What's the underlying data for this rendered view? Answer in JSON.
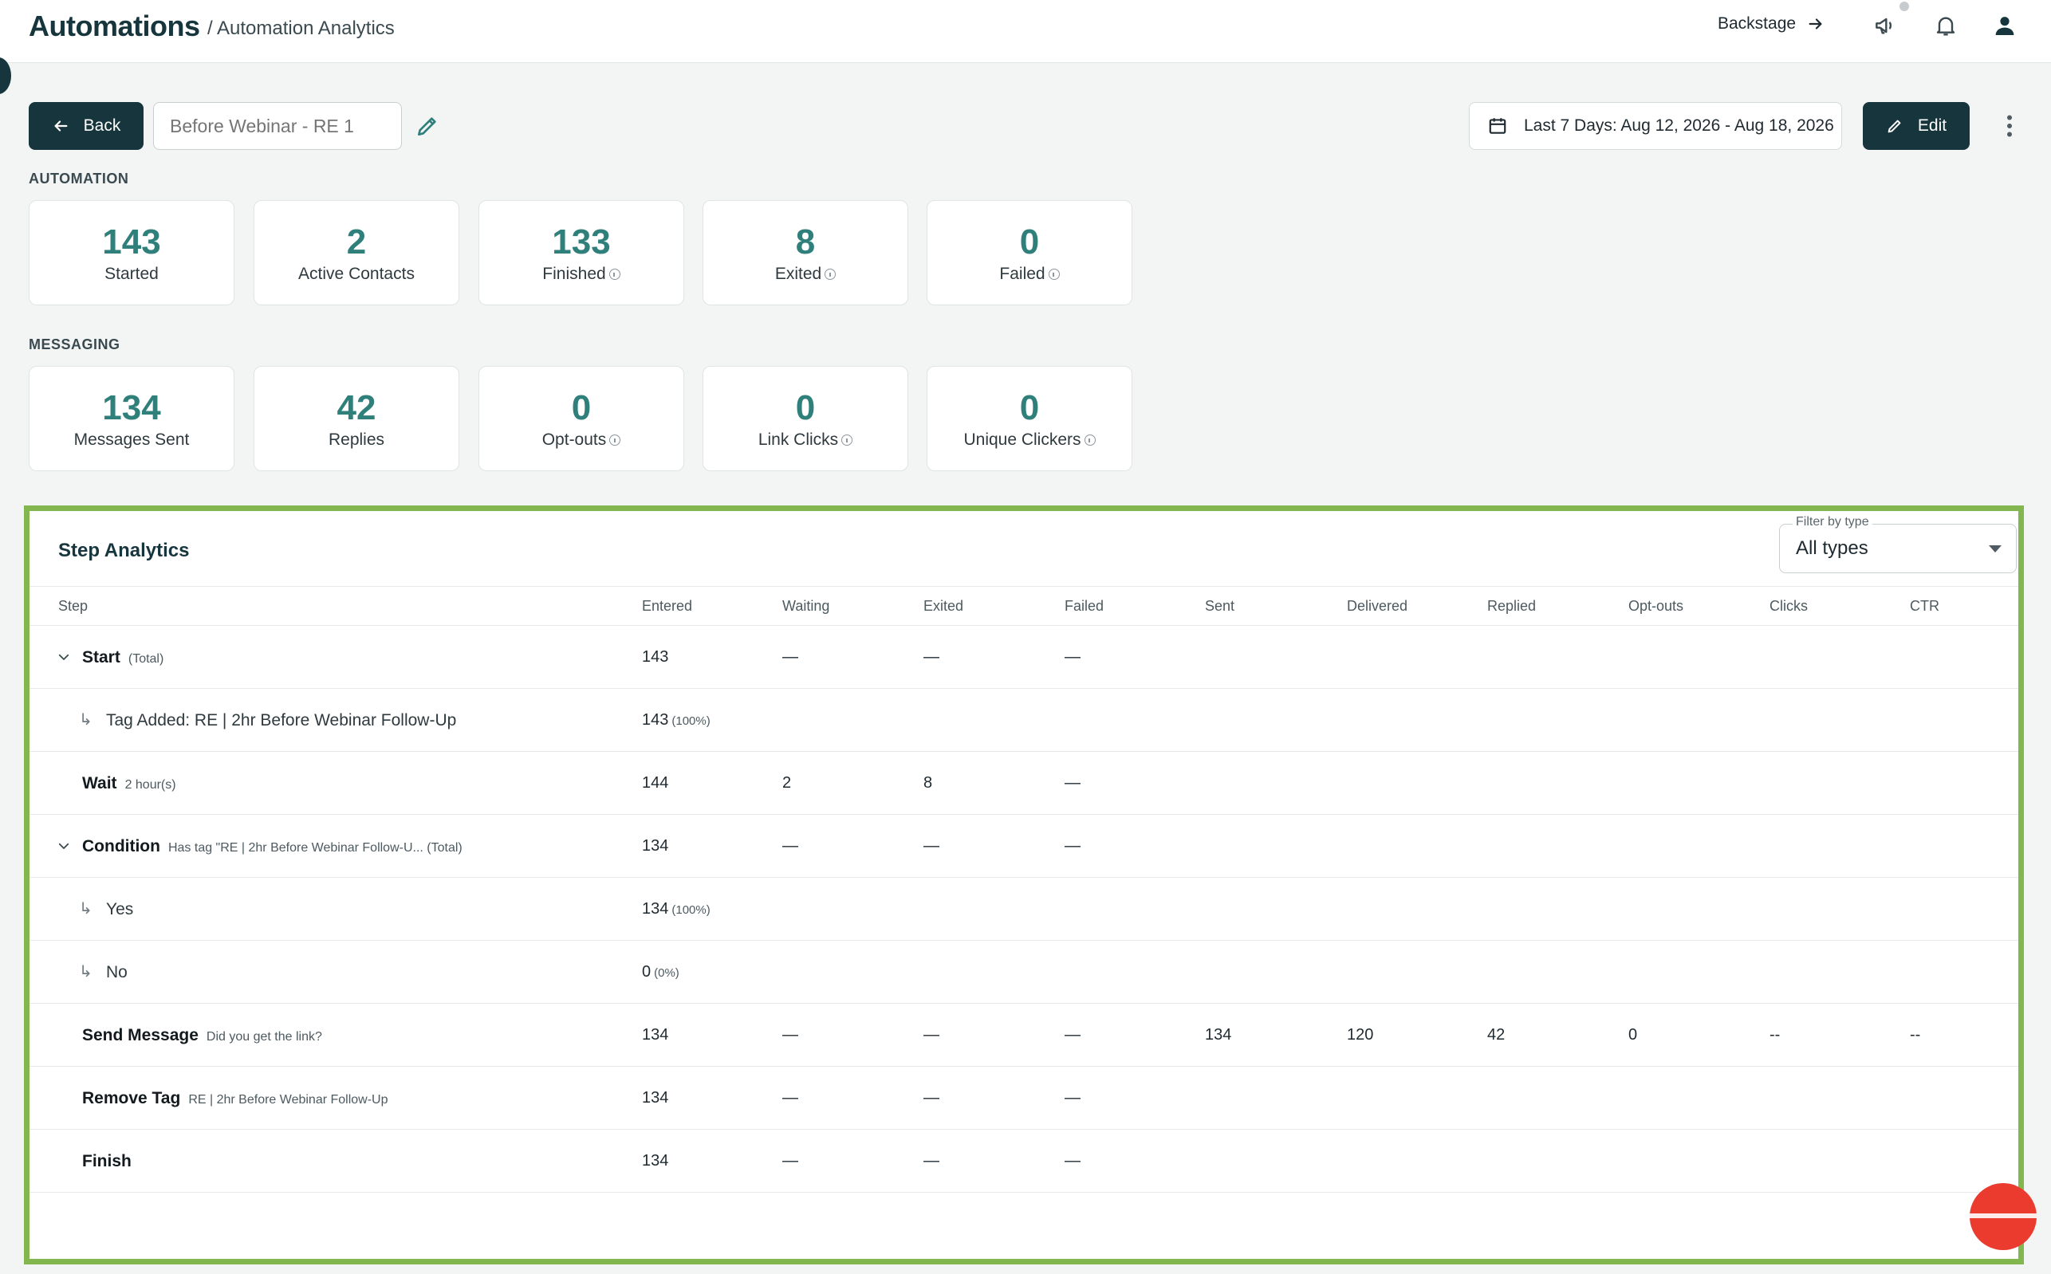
{
  "header": {
    "app_title": "Automations",
    "breadcrumb": "/ Automation Analytics",
    "backstage_label": "Backstage",
    "icons": [
      "announcement-icon",
      "bell-icon",
      "user-icon"
    ]
  },
  "toolbar": {
    "back_label": "Back",
    "automation_name_placeholder": "Before Webinar - RE 1",
    "date_range_label": "Last 7 Days: Aug 12, 2026 - Aug 18, 2026",
    "edit_label": "Edit"
  },
  "automation": {
    "section_label": "AUTOMATION",
    "metrics": [
      {
        "value": "143",
        "label": "Started",
        "info": false
      },
      {
        "value": "2",
        "label": "Active Contacts",
        "info": false
      },
      {
        "value": "133",
        "label": "Finished",
        "info": true
      },
      {
        "value": "8",
        "label": "Exited",
        "info": true
      },
      {
        "value": "0",
        "label": "Failed",
        "info": true
      }
    ]
  },
  "messaging": {
    "section_label": "MESSAGING",
    "metrics": [
      {
        "value": "134",
        "label": "Messages Sent",
        "info": false
      },
      {
        "value": "42",
        "label": "Replies",
        "info": false
      },
      {
        "value": "0",
        "label": "Opt-outs",
        "info": true
      },
      {
        "value": "0",
        "label": "Link Clicks",
        "info": true
      },
      {
        "value": "0",
        "label": "Unique Clickers",
        "info": true
      }
    ]
  },
  "step_analytics": {
    "title": "Step Analytics",
    "filter": {
      "label": "Filter by type",
      "value": "All types"
    },
    "columns": [
      "Step",
      "Entered",
      "Waiting",
      "Exited",
      "Failed",
      "Sent",
      "Delivered",
      "Replied",
      "Opt-outs",
      "Clicks",
      "CTR"
    ],
    "rows": [
      {
        "name": "Start",
        "sub": "(Total)",
        "kind": "group",
        "cells": [
          "143",
          "—",
          "—",
          "—",
          "",
          "",
          "",
          "",
          "",
          ""
        ]
      },
      {
        "name": "Tag Added: RE | 2hr Before Webinar Follow-Up",
        "sub": "",
        "kind": "branch",
        "entered_pct": "(100%)",
        "cells": [
          "143",
          "",
          "",
          "",
          "",
          "",
          "",
          "",
          "",
          ""
        ]
      },
      {
        "name": "Wait",
        "sub": "2 hour(s)",
        "kind": "step",
        "cells": [
          "144",
          "2",
          "8",
          "—",
          "",
          "",
          "",
          "",
          "",
          ""
        ]
      },
      {
        "name": "Condition",
        "sub": "Has tag \"RE | 2hr Before Webinar Follow-U...   (Total)",
        "kind": "group",
        "cells": [
          "134",
          "—",
          "—",
          "—",
          "",
          "",
          "",
          "",
          "",
          ""
        ]
      },
      {
        "name": "Yes",
        "sub": "",
        "kind": "branch",
        "entered_pct": "(100%)",
        "cells": [
          "134",
          "",
          "",
          "",
          "",
          "",
          "",
          "",
          "",
          ""
        ]
      },
      {
        "name": "No",
        "sub": "",
        "kind": "branch",
        "entered_pct": "(0%)",
        "cells": [
          "0",
          "",
          "",
          "",
          "",
          "",
          "",
          "",
          "",
          ""
        ]
      },
      {
        "name": "Send Message",
        "sub": "Did you get the link?",
        "kind": "step",
        "cells": [
          "134",
          "—",
          "—",
          "—",
          "134",
          "120",
          "42",
          "0",
          "--",
          "--"
        ]
      },
      {
        "name": "Remove Tag",
        "sub": "RE | 2hr Before Webinar Follow-Up",
        "kind": "step",
        "cells": [
          "134",
          "—",
          "—",
          "—",
          "",
          "",
          "",
          "",
          "",
          ""
        ]
      },
      {
        "name": "Finish",
        "sub": "",
        "kind": "step",
        "cells": [
          "134",
          "—",
          "—",
          "—",
          "",
          "",
          "",
          "",
          "",
          ""
        ]
      }
    ]
  }
}
